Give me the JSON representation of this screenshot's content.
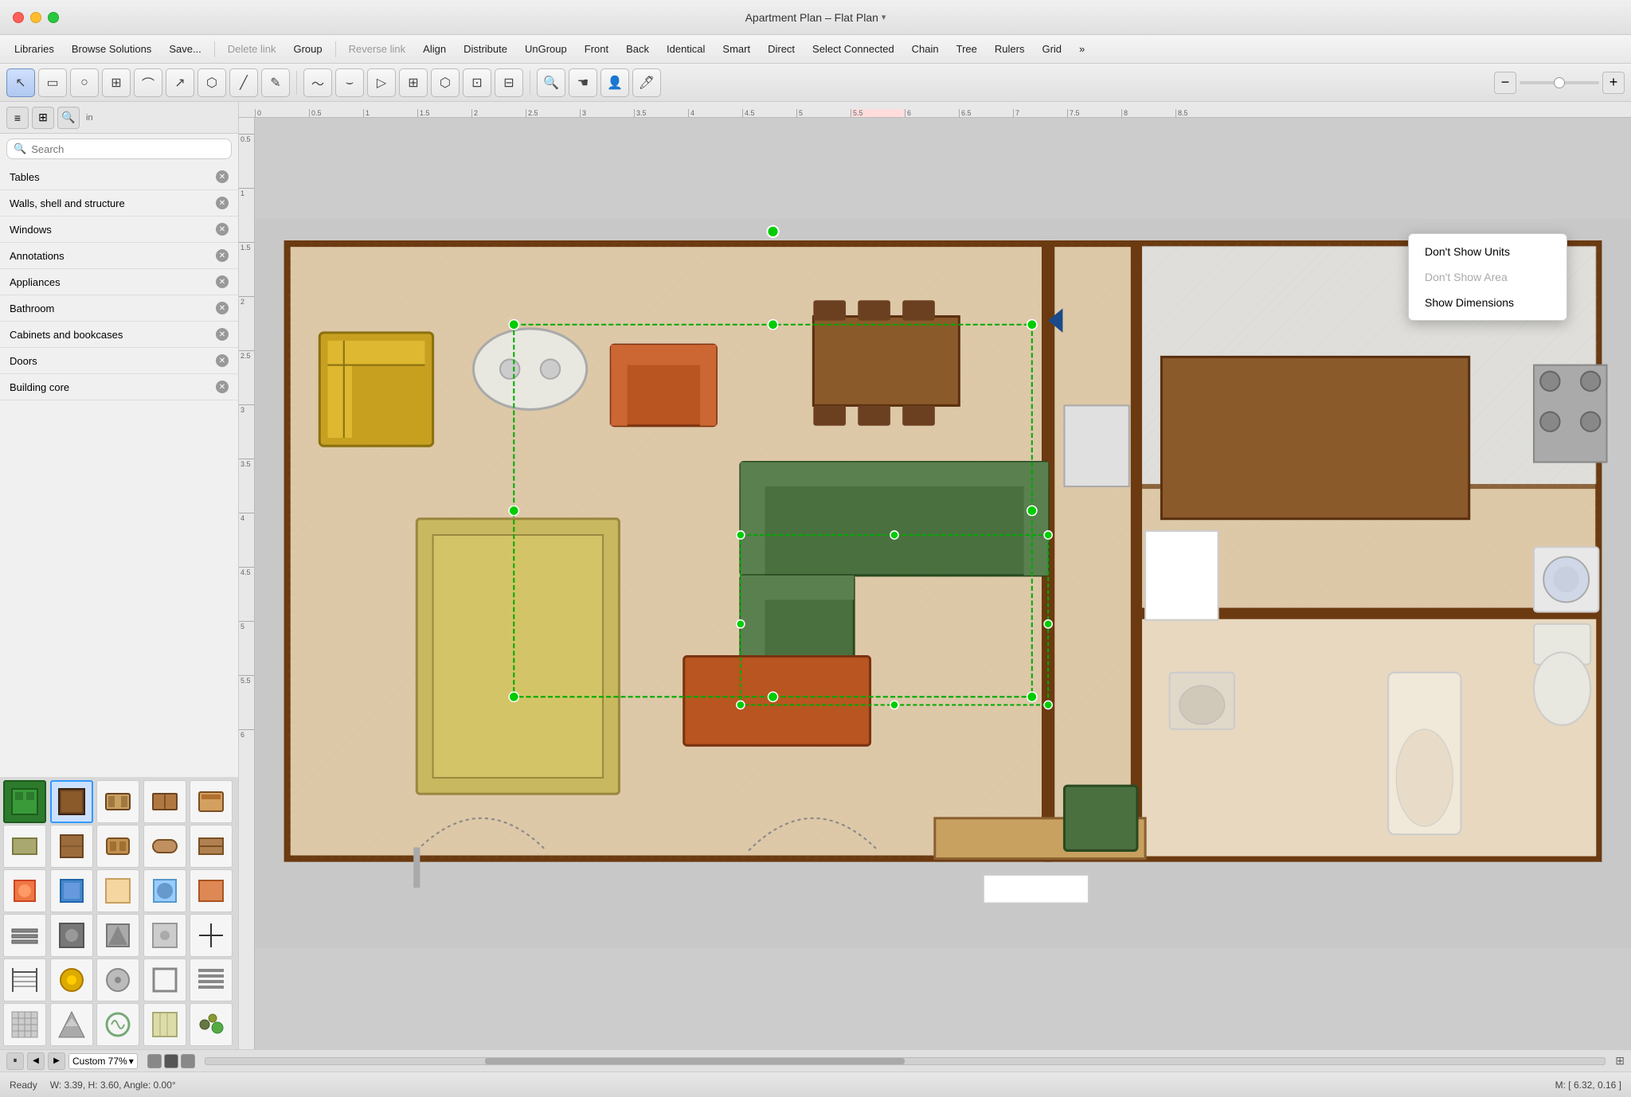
{
  "titlebar": {
    "title": "Apartment Plan – Flat Plan",
    "dropdown_arrow": "▾"
  },
  "menubar": {
    "items": [
      {
        "id": "libraries",
        "label": "Libraries",
        "disabled": false
      },
      {
        "id": "browse-solutions",
        "label": "Browse Solutions",
        "disabled": false
      },
      {
        "id": "save",
        "label": "Save...",
        "disabled": false
      },
      {
        "id": "sep1",
        "type": "separator"
      },
      {
        "id": "delete-link",
        "label": "Delete link",
        "disabled": true
      },
      {
        "id": "group",
        "label": "Group",
        "disabled": false
      },
      {
        "id": "sep2",
        "type": "separator"
      },
      {
        "id": "reverse-link",
        "label": "Reverse link",
        "disabled": true
      },
      {
        "id": "align",
        "label": "Align",
        "disabled": false
      },
      {
        "id": "distribute",
        "label": "Distribute",
        "disabled": false
      },
      {
        "id": "ungroup",
        "label": "UnGroup",
        "disabled": false
      },
      {
        "id": "front",
        "label": "Front",
        "disabled": false
      },
      {
        "id": "back",
        "label": "Back",
        "disabled": false
      },
      {
        "id": "identical",
        "label": "Identical",
        "disabled": false
      },
      {
        "id": "smart",
        "label": "Smart",
        "disabled": false
      },
      {
        "id": "direct",
        "label": "Direct",
        "disabled": false
      },
      {
        "id": "select-connected",
        "label": "Select Connected",
        "disabled": false
      },
      {
        "id": "chain",
        "label": "Chain",
        "disabled": false
      },
      {
        "id": "tree",
        "label": "Tree",
        "disabled": false
      },
      {
        "id": "rulers",
        "label": "Rulers",
        "disabled": false
      },
      {
        "id": "grid",
        "label": "Grid",
        "disabled": false
      },
      {
        "id": "more",
        "label": "»",
        "disabled": false
      }
    ]
  },
  "toolbar": {
    "tools": [
      {
        "id": "select",
        "icon": "↖",
        "active": true
      },
      {
        "id": "rect",
        "icon": "▭"
      },
      {
        "id": "ellipse",
        "icon": "○"
      },
      {
        "id": "table",
        "icon": "⊞"
      },
      {
        "id": "curve",
        "icon": "⌒"
      },
      {
        "id": "connector",
        "icon": "↗"
      },
      {
        "id": "shape",
        "icon": "⬡"
      },
      {
        "id": "line",
        "icon": "╱"
      },
      {
        "id": "path",
        "icon": "✎"
      },
      {
        "id": "sep1",
        "type": "separator"
      },
      {
        "id": "freeform",
        "icon": "〜"
      },
      {
        "id": "arc",
        "icon": "⌣"
      },
      {
        "id": "poly",
        "icon": "▷"
      },
      {
        "id": "stamp",
        "icon": "⊞"
      },
      {
        "id": "lasso",
        "icon": "⬡"
      },
      {
        "id": "sep2",
        "type": "separator"
      },
      {
        "id": "move",
        "icon": "✋"
      },
      {
        "id": "rotate",
        "icon": "↻"
      },
      {
        "id": "mirror",
        "icon": "⟺"
      },
      {
        "id": "scale",
        "icon": "⤡"
      },
      {
        "id": "sep3",
        "type": "separator"
      },
      {
        "id": "search-tool",
        "icon": "🔍"
      },
      {
        "id": "pan",
        "icon": "☚"
      },
      {
        "id": "person",
        "icon": "👤"
      },
      {
        "id": "pen",
        "icon": "🖊"
      }
    ],
    "zoom_out": "−",
    "zoom_in": "+"
  },
  "sidebar": {
    "search_placeholder": "Search",
    "unit_label": "in",
    "categories": [
      {
        "id": "tables",
        "label": "Tables",
        "has_close": true
      },
      {
        "id": "walls",
        "label": "Walls, shell and structure",
        "has_close": true
      },
      {
        "id": "windows",
        "label": "Windows",
        "has_close": true
      },
      {
        "id": "annotations",
        "label": "Annotations",
        "has_close": true
      },
      {
        "id": "appliances",
        "label": "Appliances",
        "has_close": true
      },
      {
        "id": "bathroom",
        "label": "Bathroom",
        "has_close": true
      },
      {
        "id": "cabinets",
        "label": "Cabinets and bookcases",
        "has_close": true
      },
      {
        "id": "doors",
        "label": "Doors",
        "has_close": true
      },
      {
        "id": "building-core",
        "label": "Building core",
        "has_close": true
      }
    ],
    "icons": [
      {
        "id": "i1",
        "color": "#2d7a2d",
        "selected": false
      },
      {
        "id": "i2",
        "color": "#5a3a1a",
        "selected": true
      },
      {
        "id": "i3",
        "color": "#8b5a2b",
        "selected": false
      },
      {
        "id": "i4",
        "color": "#8b4513",
        "selected": false
      },
      {
        "id": "i5",
        "color": "#c87941",
        "selected": false
      },
      {
        "id": "i6",
        "color": "#8b8b6b",
        "selected": false
      },
      {
        "id": "i7",
        "color": "#7a5533",
        "selected": false
      },
      {
        "id": "i8",
        "color": "#9b6b3b",
        "selected": false
      },
      {
        "id": "i9",
        "color": "#a07040",
        "selected": false
      },
      {
        "id": "i10",
        "color": "#b08050",
        "selected": false
      },
      {
        "id": "i11",
        "color": "#cc7744",
        "selected": false
      },
      {
        "id": "i12",
        "color": "#4488cc",
        "selected": false
      },
      {
        "id": "i13",
        "color": "#f5d5a0",
        "selected": false
      },
      {
        "id": "i14",
        "color": "#6699cc",
        "selected": false
      },
      {
        "id": "i15",
        "color": "#cc8855",
        "selected": false
      },
      {
        "id": "i16",
        "color": "#ddaa77",
        "selected": false
      },
      {
        "id": "i17",
        "color": "#4499cc",
        "selected": false
      },
      {
        "id": "i18",
        "color": "#ee8833",
        "selected": false
      },
      {
        "id": "i19",
        "color": "#888888",
        "selected": false
      },
      {
        "id": "i20",
        "color": "#444444",
        "selected": false
      },
      {
        "id": "i21",
        "color": "#888866",
        "selected": false
      },
      {
        "id": "i22",
        "color": "#777777",
        "selected": false
      },
      {
        "id": "i23",
        "color": "#999966",
        "selected": false
      },
      {
        "id": "i24",
        "color": "#bbaacc",
        "selected": false
      },
      {
        "id": "i25",
        "color": "#ccaa00",
        "selected": false
      },
      {
        "id": "i26",
        "color": "#999988",
        "selected": false
      },
      {
        "id": "i27",
        "color": "#cccccc",
        "selected": false
      },
      {
        "id": "i28",
        "color": "#eeeeee",
        "selected": false
      },
      {
        "id": "i29",
        "color": "#bbbb88",
        "selected": false
      },
      {
        "id": "i30",
        "color": "#aaaaaa",
        "selected": false
      }
    ]
  },
  "context_menu": {
    "items": [
      {
        "id": "dont-show-units",
        "label": "Don't Show Units",
        "disabled": false
      },
      {
        "id": "dont-show-area",
        "label": "Don't Show Area",
        "disabled": true
      },
      {
        "id": "show-dimensions",
        "label": "Show Dimensions",
        "disabled": false
      }
    ]
  },
  "statusbar": {
    "ready_label": "Ready",
    "dimensions": "W: 3.39,  H: 3.60,  Angle: 0.00°",
    "coordinates": "M: [ 6.32, 0.16 ]"
  },
  "bottombar": {
    "zoom_label": "Custom 77%",
    "prev_arrow": "◀",
    "next_arrow": "▶",
    "pause_icon": "⏸"
  },
  "ruler": {
    "marks": [
      "0",
      "0.5",
      "1",
      "1.5",
      "2",
      "2.5",
      "3",
      "3.5",
      "4",
      "4.5",
      "5",
      "5.5",
      "6",
      "6.5",
      "7",
      "7.5",
      "8",
      "8.5"
    ]
  }
}
